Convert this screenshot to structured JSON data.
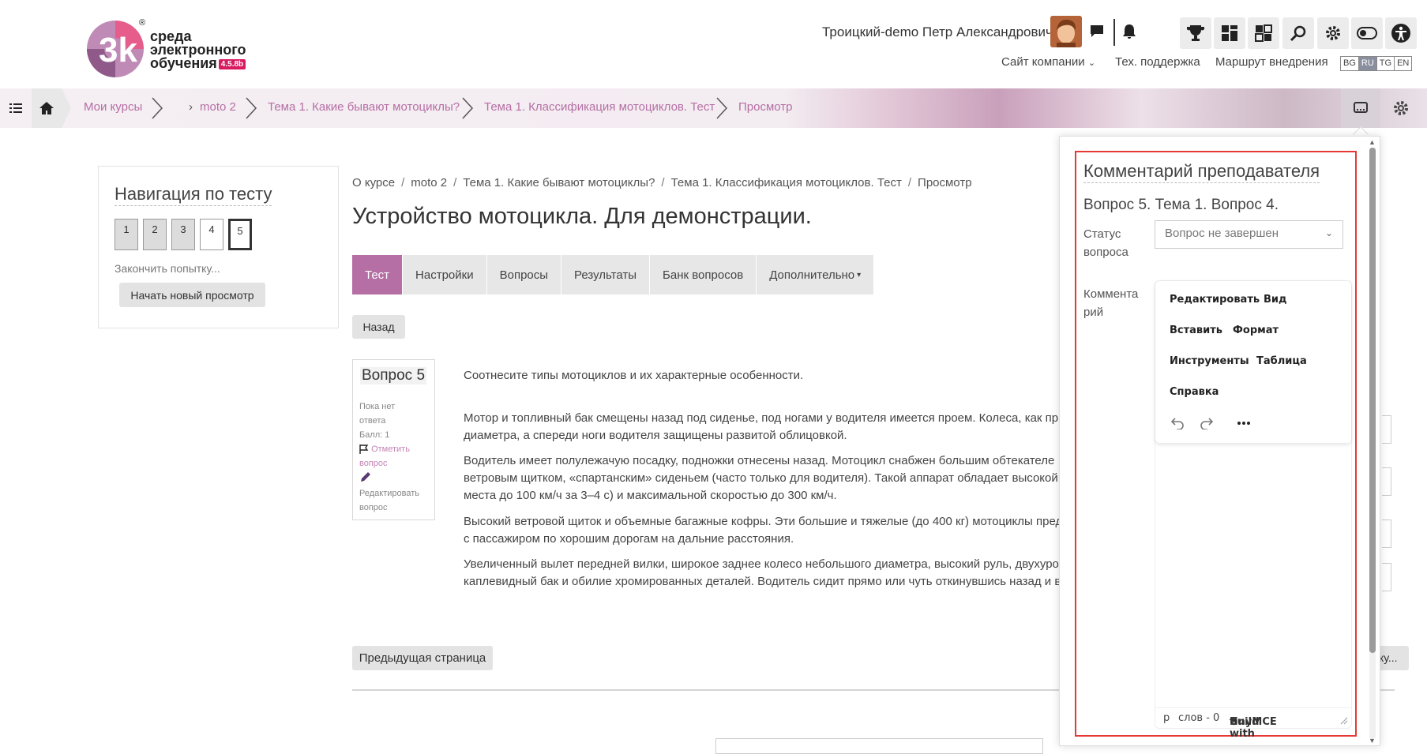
{
  "header": {
    "logo_line1": "среда",
    "logo_line2": "электронного",
    "logo_line3": "обучения",
    "logo_version": "4.5.8b",
    "logo_mark": "3k",
    "user_name": "Троицкий-demo Петр Александрович",
    "menu": {
      "company_site": "Сайт компании",
      "support": "Тех. поддержка",
      "route": "Маршрут внедрения"
    },
    "languages": [
      "BG",
      "RU",
      "TG",
      "EN"
    ],
    "active_language": "RU"
  },
  "breadcrumb_bar": {
    "items": [
      "Мои курсы",
      "moto 2",
      "Тема 1. Какие бывают мотоциклы?",
      "Тема 1. Классификация мотоциклов. Тест",
      "Просмотр"
    ]
  },
  "nav_block": {
    "title": "Навигация по тесту",
    "questions": [
      "1",
      "2",
      "3",
      "4",
      "5"
    ],
    "current_question": "5",
    "finish_link": "Закончить попытку...",
    "new_preview_button": "Начать новый просмотр"
  },
  "main": {
    "crumbs": [
      "О курсе",
      "moto 2",
      "Тема 1. Какие бывают мотоциклы?",
      "Тема 1. Классификация мотоциклов. Тест",
      "Просмотр"
    ],
    "title": "Устройство мотоцикла. Для демонстрации.",
    "tabs": [
      "Тест",
      "Настройки",
      "Вопросы",
      "Результаты",
      "Банк вопросов",
      "Дополнительно"
    ],
    "active_tab": "Тест",
    "back_button": "Назад",
    "question": {
      "title": "Вопрос 5",
      "status_line1": "Пока нет",
      "status_line2": "ответа",
      "score": "Балл: 1",
      "flag_line1": "Отметить",
      "flag_line2": "вопрос",
      "edit_line1": "Редактировать",
      "edit_line2": "вопрос"
    },
    "prompt": "Соотнесите типы мотоциклов и их характерные особенности.",
    "paragraphs": [
      [
        "Мотор и топливный бак смещены назад под сиденье, под ногами у водителя имеется проем. Колеса, как пр",
        "диаметра, а спереди ноги водителя защищены развитой облицовкой."
      ],
      [
        "Водитель имеет полулежачую посадку, подножки отнесены назад. Мотоцикл снабжен большим обтекателе",
        "ветровым щитком, «спартанским» сиденьем (часто только для водителя). Такой аппарат обладает высокой д",
        "места до 100 км/ч за 3–4 с) и максимальной скоростью до 300 км/ч."
      ],
      [
        "Высокий ветровой щиток и объемные багажные кофры. Эти большие и тяжелые (до 400 кг) мотоциклы пред",
        "с пассажиром по хорошим дорогам на дальние расстояния."
      ],
      [
        "Увеличенный вылет передней вилки, широкое заднее колесо небольшого диаметра, высокий руль, двухуро",
        "каплевидный бак и обилие хромированных деталей. Водитель сидит прямо или чуть откинувшись назад и в"
      ]
    ],
    "prev_page_button": "Предыдущая страница",
    "right_peek_button": "ку..."
  },
  "comment_panel": {
    "title": "Комментарий преподавателя",
    "question_label": "Вопрос 5. Тема 1. Вопрос 4.",
    "status_label_1": "Статус",
    "status_label_2": "вопроса",
    "status_value": "Вопрос не завершен",
    "comment_label_1": "Коммента",
    "comment_label_2": "рий",
    "editor_menu": [
      "Редактировать",
      "Вид",
      "Вставить",
      "Формат",
      "Инструменты",
      "Таблица",
      "Справка"
    ],
    "status_path": "p",
    "word_count": "слов - 0",
    "build_with": "Build with",
    "tinymce": "tinyMCE"
  },
  "colors": {
    "accent": "#b56fa4",
    "red_outline": "#e53935",
    "logo_pink": "#d81b60"
  }
}
